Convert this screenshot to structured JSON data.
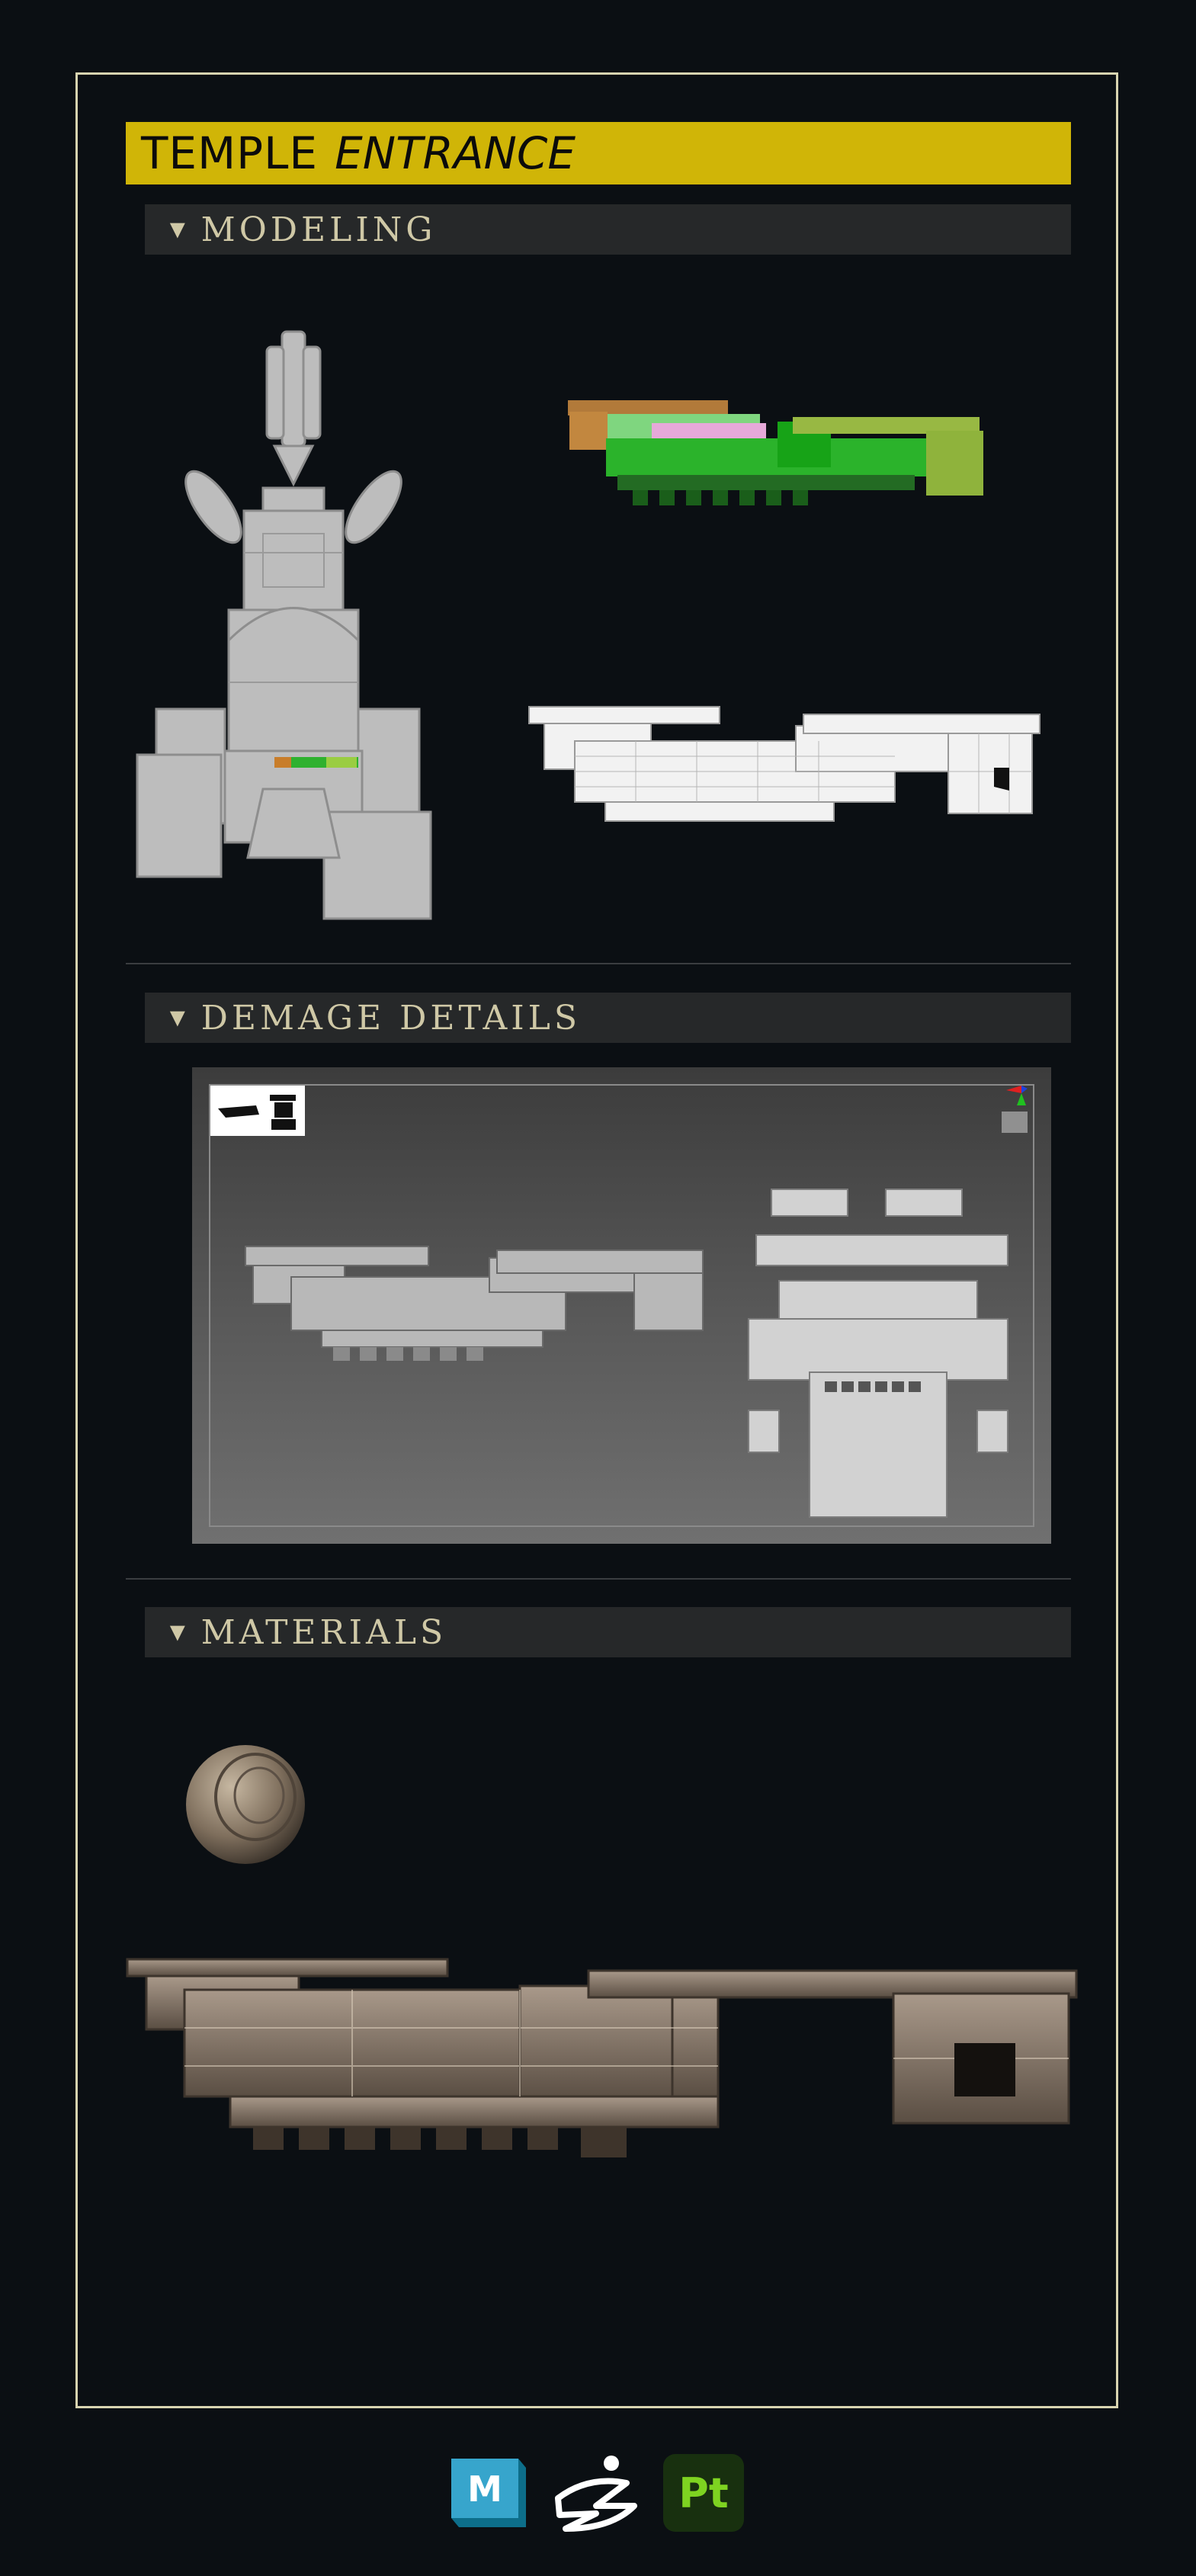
{
  "header": {
    "title_main": "TEMPLE",
    "title_accent": "ENTRANCE"
  },
  "sections": {
    "modeling": "MODELING",
    "damage": "DEMAGE DETAILS",
    "materials": "MATERIALS"
  },
  "section_marker": "▼",
  "tools": {
    "maya": "M",
    "painter": "Pt"
  },
  "colors": {
    "title_bar": "#d0b507",
    "section_bar": "#262829",
    "section_text": "#cfc8a6",
    "frame": "#d8d4b0",
    "background": "#0b0f13"
  },
  "icons": [
    "maya-icon",
    "zbrush-icon",
    "substance-painter-icon"
  ]
}
